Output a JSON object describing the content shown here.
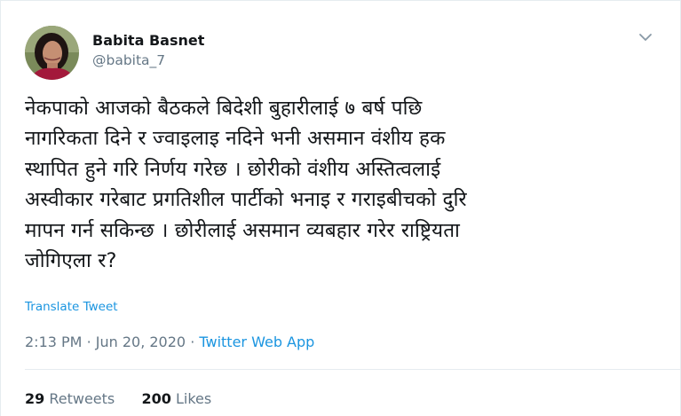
{
  "author": {
    "name": "Babita Basnet",
    "handle": "@babita_7"
  },
  "tweet": {
    "lines": [
      "नेकपाको आजको बैठकले बिदेशी बुहारीलाई ७ बर्ष पछि",
      "नागरिकता दिने र ज्वाइलाइ नदिने भनी असमान वंशीय हक",
      "स्थापित हुने गरि निर्णय गरेछ । छोरीको वंशीय अस्तित्वलाई",
      "अस्वीकार गरेबाट प्रगतिशील पार्टीको भनाइ र गराइबीचको दुरि",
      "मापन गर्न सकिन्छ । छोरीलाई असमान व्यबहार गरेर राष्ट्रियता",
      "जोगिएला र?"
    ],
    "translate_label": "Translate Tweet",
    "time": "2:13 PM",
    "separator": "·",
    "date": "Jun 20, 2020",
    "app": "Twitter Web App"
  },
  "stats": {
    "retweets_count": "29",
    "retweets_label": "Retweets",
    "likes_count": "200",
    "likes_label": "Likes"
  },
  "icons": {
    "caret": "chevron-down-icon",
    "avatar": "avatar-photo"
  },
  "colors": {
    "link": "#1b95e0",
    "muted": "#657786",
    "text": "#14171a",
    "border": "#e6ecf0"
  }
}
